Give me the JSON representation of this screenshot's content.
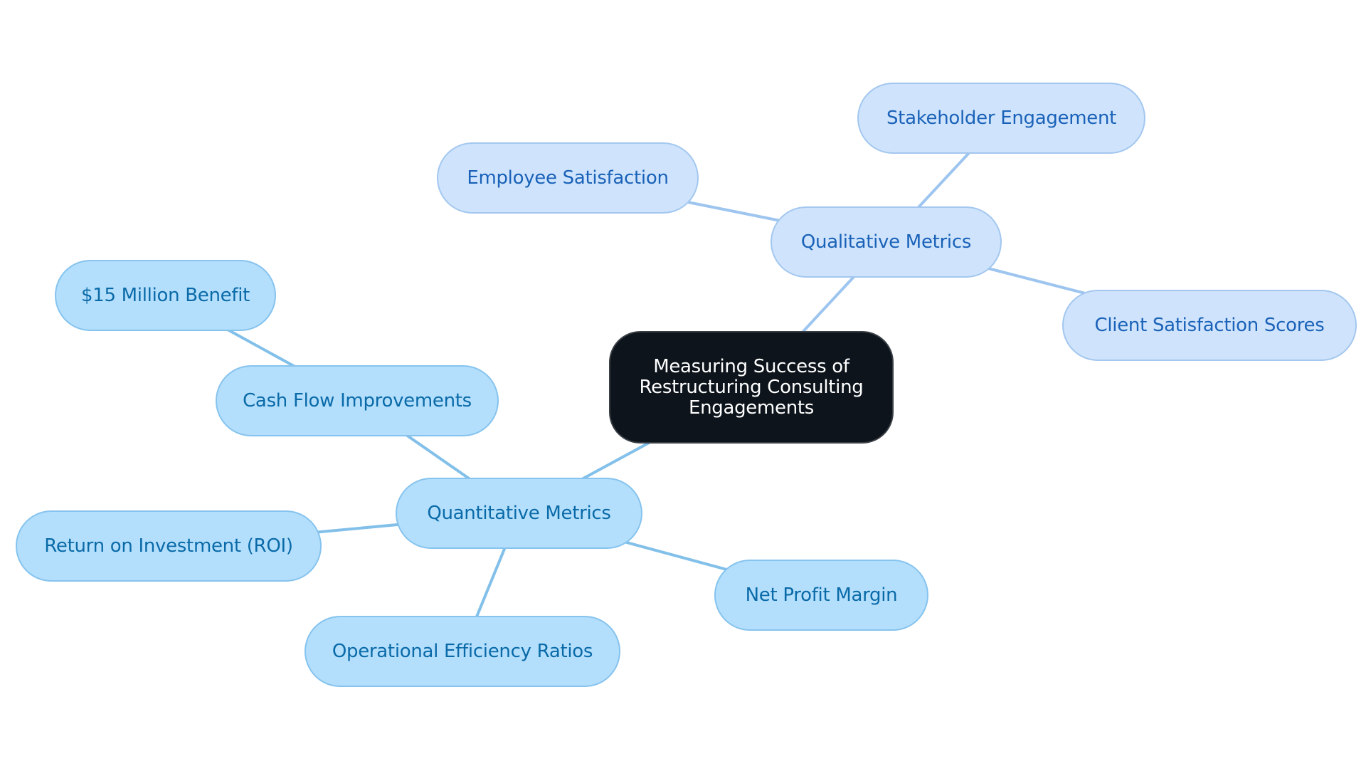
{
  "diagram": {
    "type": "mind-map",
    "root": {
      "id": "root",
      "label": "Measuring Success of Restructuring Consulting Engagements"
    },
    "branches": [
      {
        "id": "qual",
        "label": "Qualitative Metrics",
        "color": "#cfe4fc",
        "text_color": "#1a62b8",
        "children": [
          {
            "id": "stake",
            "label": "Stakeholder Engagement"
          },
          {
            "id": "emp",
            "label": "Employee Satisfaction"
          },
          {
            "id": "client",
            "label": "Client Satisfaction Scores"
          }
        ]
      },
      {
        "id": "quant",
        "label": "Quantitative Metrics",
        "color": "#b3dffc",
        "text_color": "#0a6aa8",
        "children": [
          {
            "id": "cash",
            "label": "Cash Flow Improvements",
            "children": [
              {
                "id": "15m",
                "label": "$15 Million Benefit"
              }
            ]
          },
          {
            "id": "roi",
            "label": "Return on Investment (ROI)"
          },
          {
            "id": "ops",
            "label": "Operational Efficiency Ratios"
          },
          {
            "id": "npm",
            "label": "Net Profit Margin"
          }
        ]
      }
    ],
    "root_color": "#0d141b",
    "edges": [
      {
        "from": "root",
        "to": "qual",
        "branch": "qual"
      },
      {
        "from": "qual",
        "to": "stake",
        "branch": "qual"
      },
      {
        "from": "qual",
        "to": "emp",
        "branch": "qual"
      },
      {
        "from": "qual",
        "to": "client",
        "branch": "qual"
      },
      {
        "from": "root",
        "to": "quant",
        "branch": "quant"
      },
      {
        "from": "quant",
        "to": "cash",
        "branch": "quant"
      },
      {
        "from": "cash",
        "to": "15m",
        "branch": "quant"
      },
      {
        "from": "quant",
        "to": "roi",
        "branch": "quant"
      },
      {
        "from": "quant",
        "to": "ops",
        "branch": "quant"
      },
      {
        "from": "quant",
        "to": "npm",
        "branch": "quant"
      }
    ]
  }
}
